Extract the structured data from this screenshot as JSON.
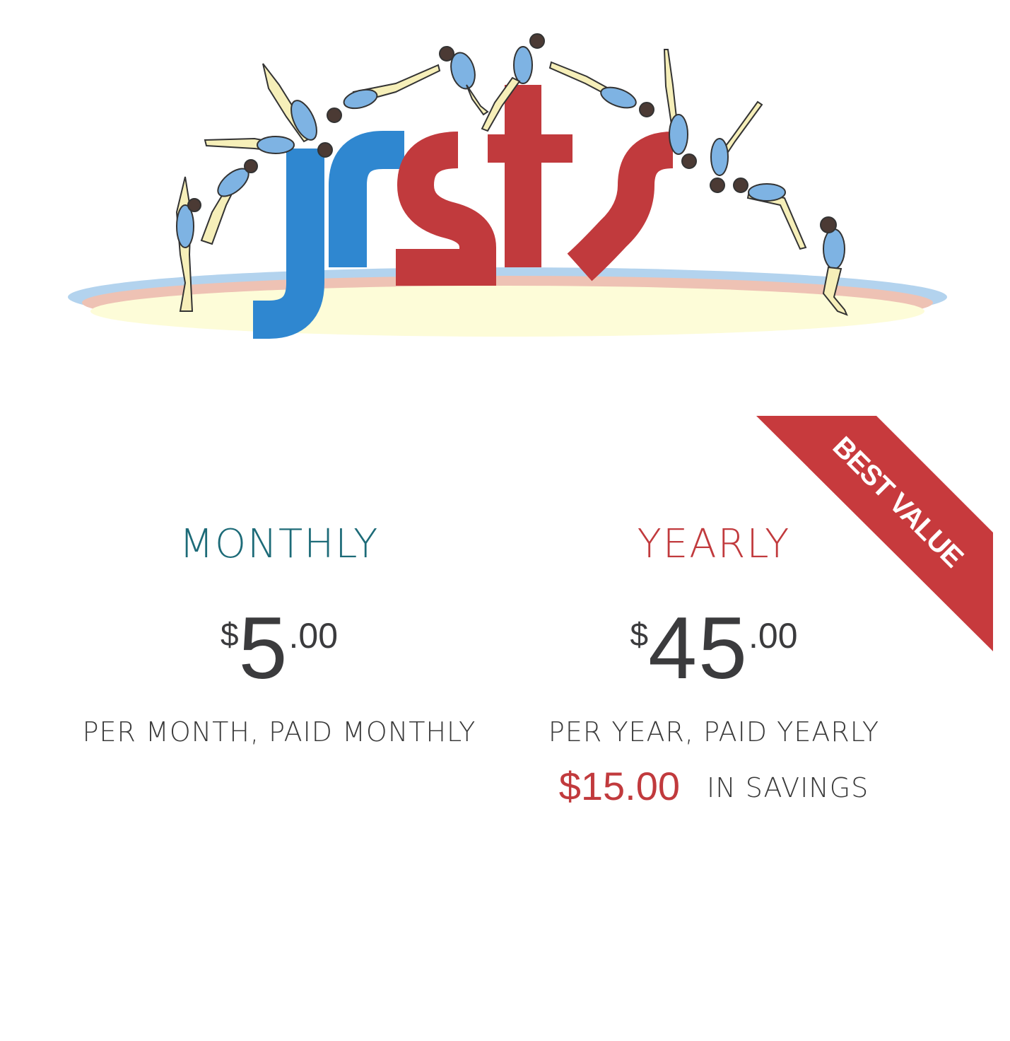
{
  "brand": {
    "logo_text": "jrsts"
  },
  "badge": {
    "text": "BEST VALUE",
    "color": "#c73a3d"
  },
  "plans": {
    "monthly": {
      "title": "MONTHLY",
      "title_color": "#1d6b78",
      "currency": "$",
      "amount": "5",
      "cents": ".00",
      "period": "PER MONTH, PAID MONTHLY"
    },
    "yearly": {
      "title": "YEARLY",
      "title_color": "#c13a3d",
      "currency": "$",
      "amount": "45",
      "cents": ".00",
      "period": "PER YEAR, PAID YEARLY",
      "savings_amount": "$15.00",
      "savings_label": "IN SAVINGS"
    }
  },
  "colors": {
    "brand_blue": "#2f87d0",
    "brand_red": "#c13a3d",
    "price_text": "#3b3b3d"
  }
}
